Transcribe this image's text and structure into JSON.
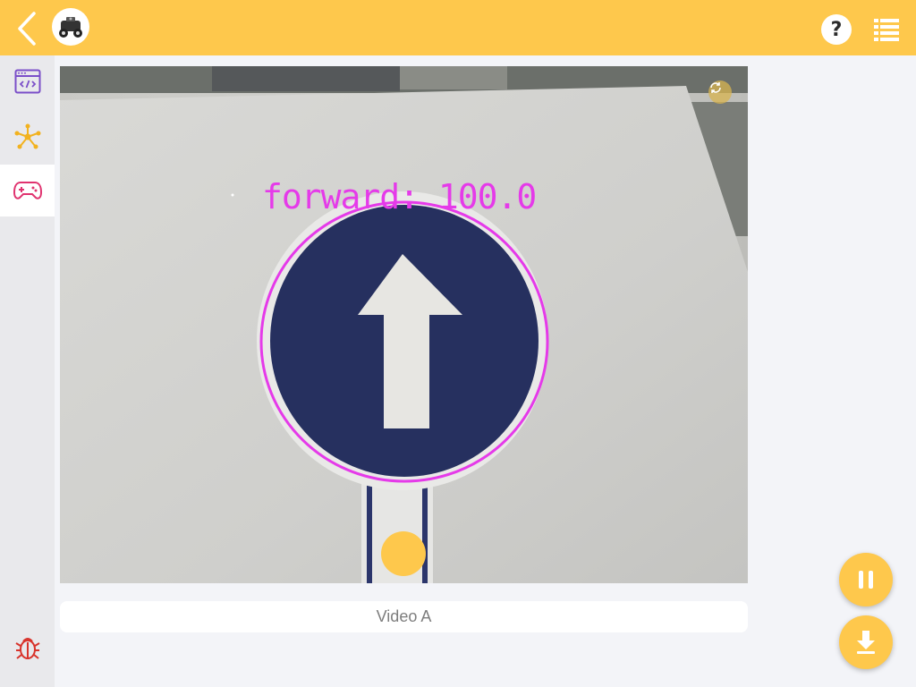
{
  "header": {
    "back_icon": "chevron-left-icon",
    "avatar_icon": "robot-car-icon",
    "help_label": "?",
    "menu_icon": "list-icon"
  },
  "sidebar": {
    "items": [
      {
        "icon": "code-window-icon",
        "color": "#7b4fc9",
        "active": false
      },
      {
        "icon": "network-nodes-icon",
        "color": "#f2b21f",
        "active": false
      },
      {
        "icon": "gamepad-icon",
        "color": "#e0336f",
        "active": true
      }
    ],
    "bottom_item": {
      "icon": "bug-icon",
      "color": "#d8332b"
    }
  },
  "video": {
    "detection_label": "forward: 100.0",
    "detection_color": "#e53ae9",
    "refresh_icon": "refresh-icon",
    "shutter_icon": "record-circle-icon"
  },
  "caption": {
    "text": "Video A"
  },
  "controls": {
    "pause_icon": "pause-icon",
    "download_icon": "download-icon"
  },
  "colors": {
    "accent": "#fec84c",
    "background": "#f3f4f8",
    "sidebar": "#e9e9ec"
  }
}
